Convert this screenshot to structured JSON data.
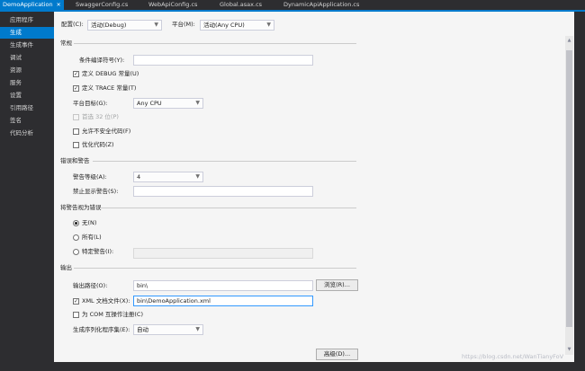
{
  "tabs": [
    {
      "label": "DemoApplication",
      "close": "✕"
    },
    {
      "label": "SwaggerConfig.cs"
    },
    {
      "label": "WebApiConfig.cs"
    },
    {
      "label": "Global.asax.cs"
    },
    {
      "label": "DynamicApiApplication.cs"
    }
  ],
  "sidebar": {
    "items": [
      {
        "label": "应用程序"
      },
      {
        "label": "生成"
      },
      {
        "label": "生成事件"
      },
      {
        "label": "调试"
      },
      {
        "label": "资源"
      },
      {
        "label": "服务"
      },
      {
        "label": "设置"
      },
      {
        "label": "引用路径"
      },
      {
        "label": "签名"
      },
      {
        "label": "代码分析"
      }
    ]
  },
  "config": {
    "label": "配置(C):",
    "value": "活动(Debug)"
  },
  "platform": {
    "label": "平台(M):",
    "value": "活动(Any CPU)"
  },
  "general": {
    "title": "常规",
    "conditional_symbols_label": "条件编译符号(Y):",
    "conditional_symbols_value": "",
    "define_debug": {
      "label": "定义 DEBUG 常量(U)",
      "checked": true
    },
    "define_trace": {
      "label": "定义 TRACE 常量(T)",
      "checked": true
    },
    "platform_target_label": "平台目标(G):",
    "platform_target_value": "Any CPU",
    "prefer32": {
      "label": "首选 32 位(P)",
      "checked": false
    },
    "allow_unsafe": {
      "label": "允许不安全代码(F)",
      "checked": false
    },
    "optimize": {
      "label": "优化代码(Z)",
      "checked": false
    }
  },
  "errors": {
    "title": "错误和警告",
    "warning_level_label": "警告等级(A):",
    "warning_level_value": "4",
    "suppress_label": "禁止显示警告(S):",
    "suppress_value": ""
  },
  "treat_warnings": {
    "title": "将警告视为错误",
    "none": "无(N)",
    "all": "所有(L)",
    "specific": "特定警告(I):",
    "specific_value": ""
  },
  "output": {
    "title": "输出",
    "path_label": "输出路径(O):",
    "path_value": "bin\\",
    "browse_label": "浏览(R)...",
    "xml_doc": {
      "label": "XML 文档文件(X):",
      "checked": true
    },
    "xml_doc_value": "bin\\DemoApplication.xml",
    "com_interop": {
      "label": "为 COM 互操作注册(C)",
      "checked": false
    },
    "serialization_label": "生成序列化程序集(E):",
    "serialization_value": "自动",
    "advanced_label": "高级(D)..."
  },
  "check_mark": "✓",
  "watermark": "https://blog.csdn.net/WanTianyFoV",
  "colors": {
    "accent": "#007acc",
    "panel": "#f5f5f5",
    "chrome": "#2d2d30"
  }
}
